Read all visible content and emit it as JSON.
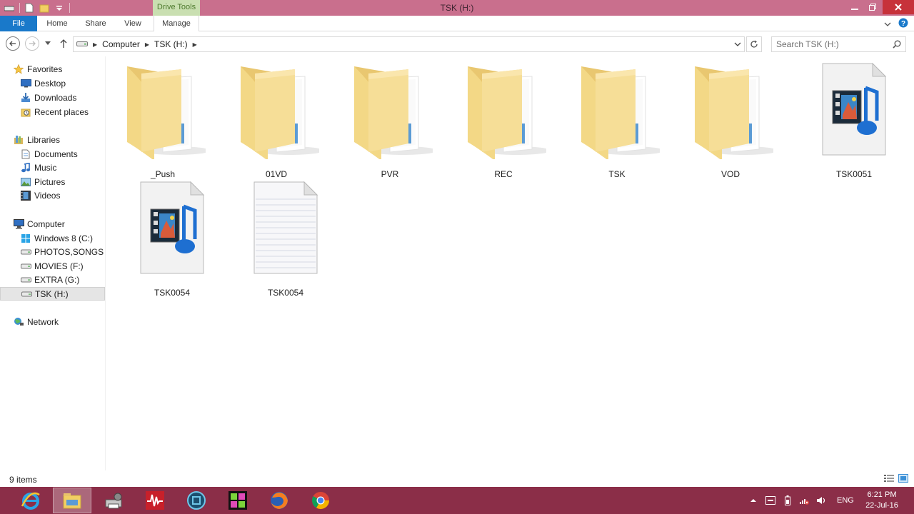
{
  "window": {
    "title": "TSK (H:)",
    "context_tab": "Drive Tools"
  },
  "ribbon": {
    "tabs": [
      {
        "label": "File"
      },
      {
        "label": "Home"
      },
      {
        "label": "Share"
      },
      {
        "label": "View"
      },
      {
        "label": "Manage"
      }
    ]
  },
  "address": {
    "crumbs": [
      "Computer",
      "TSK (H:)"
    ]
  },
  "search": {
    "placeholder": "Search TSK (H:)"
  },
  "sidebar": {
    "favorites": {
      "label": "Favorites",
      "items": [
        "Desktop",
        "Downloads",
        "Recent places"
      ]
    },
    "libraries": {
      "label": "Libraries",
      "items": [
        "Documents",
        "Music",
        "Pictures",
        "Videos"
      ]
    },
    "computer": {
      "label": "Computer",
      "items": [
        "Windows 8 (C:)",
        "PHOTOS,SONGS & VIDEOS",
        "MOVIES (F:)",
        "EXTRA (G:)",
        "TSK (H:)"
      ]
    },
    "network": {
      "label": "Network"
    }
  },
  "files": [
    {
      "name": "_Push",
      "type": "folder"
    },
    {
      "name": "01VD",
      "type": "folder"
    },
    {
      "name": "PVR",
      "type": "folder"
    },
    {
      "name": "REC",
      "type": "folder"
    },
    {
      "name": "TSK",
      "type": "folder"
    },
    {
      "name": "VOD",
      "type": "folder"
    },
    {
      "name": "TSK0051",
      "type": "media-file"
    },
    {
      "name": "TSK0054",
      "type": "media-file"
    },
    {
      "name": "TSK0054",
      "type": "text-file"
    }
  ],
  "status": {
    "item_count": "9 items"
  },
  "taskbar": {
    "apps": [
      "internet-explorer-icon",
      "file-explorer-icon",
      "printer-settings-icon",
      "audio-editor-icon",
      "media-player-icon",
      "video-editor-icon",
      "firefox-icon",
      "chrome-icon"
    ],
    "language": "ENG",
    "time": "6:21 PM",
    "date": "22-Jul-16"
  },
  "colors": {
    "titlebar": "#c96f8d",
    "file_tab": "#1979ca",
    "drive_tools": "#c9dfb1",
    "close_button": "#c7323a",
    "taskbar": "#8b2e48",
    "folder": "#f1d27c"
  }
}
